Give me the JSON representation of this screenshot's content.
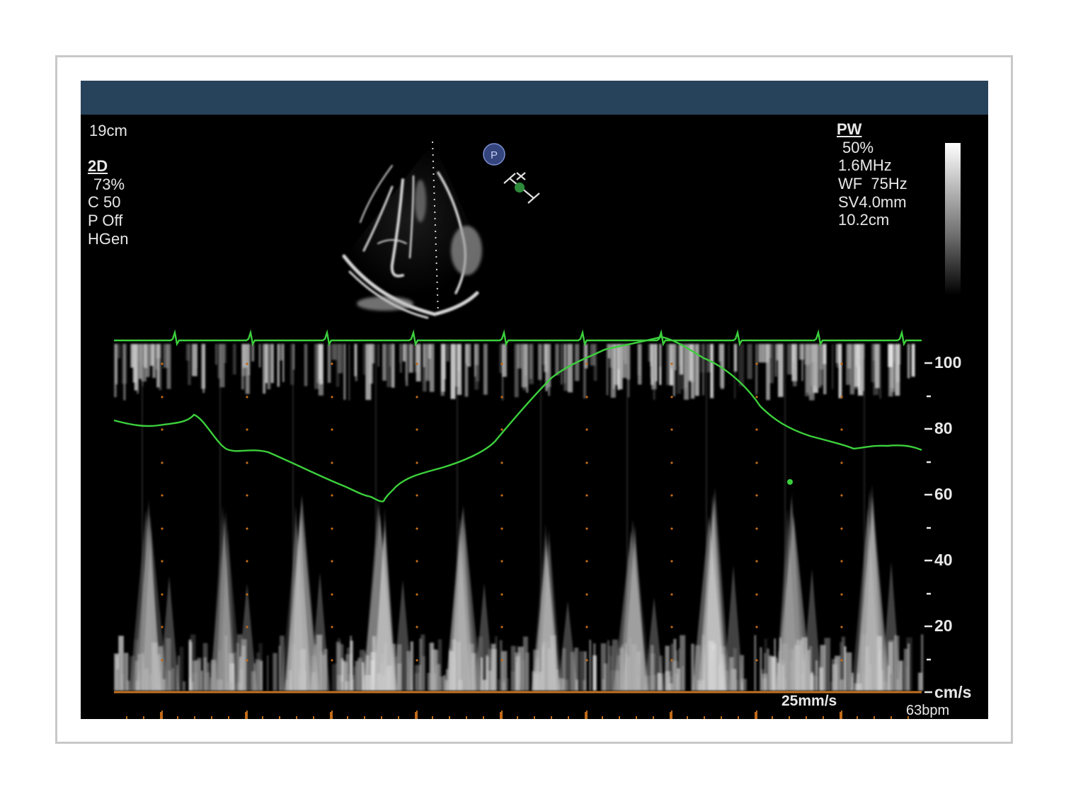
{
  "left_panel": {
    "depth": "19cm",
    "mode_title": "2D",
    "gain": "73%",
    "compression": "C 50",
    "persistence": "P Off",
    "frequency_mode": "HGen"
  },
  "right_panel": {
    "mode_title": "PW",
    "gain": "50%",
    "frequency": "1.6MHz",
    "wall_filter": "WF  75Hz",
    "sample_volume": "SV4.0mm",
    "depth": "10.2cm"
  },
  "probe_marker": "P",
  "velocity_scale": {
    "labels": [
      "100",
      "80",
      "60",
      "40",
      "20"
    ],
    "unit": "cm/s",
    "range": [
      0,
      105
    ]
  },
  "sweep_speed": "25mm/s",
  "heart_rate": "63bpm",
  "colors": {
    "background": "#000000",
    "header_bar": "#27425b",
    "trace": "#3ccf3c",
    "baseline": "#c0701e",
    "grid_dots": "#c06a1a"
  }
}
